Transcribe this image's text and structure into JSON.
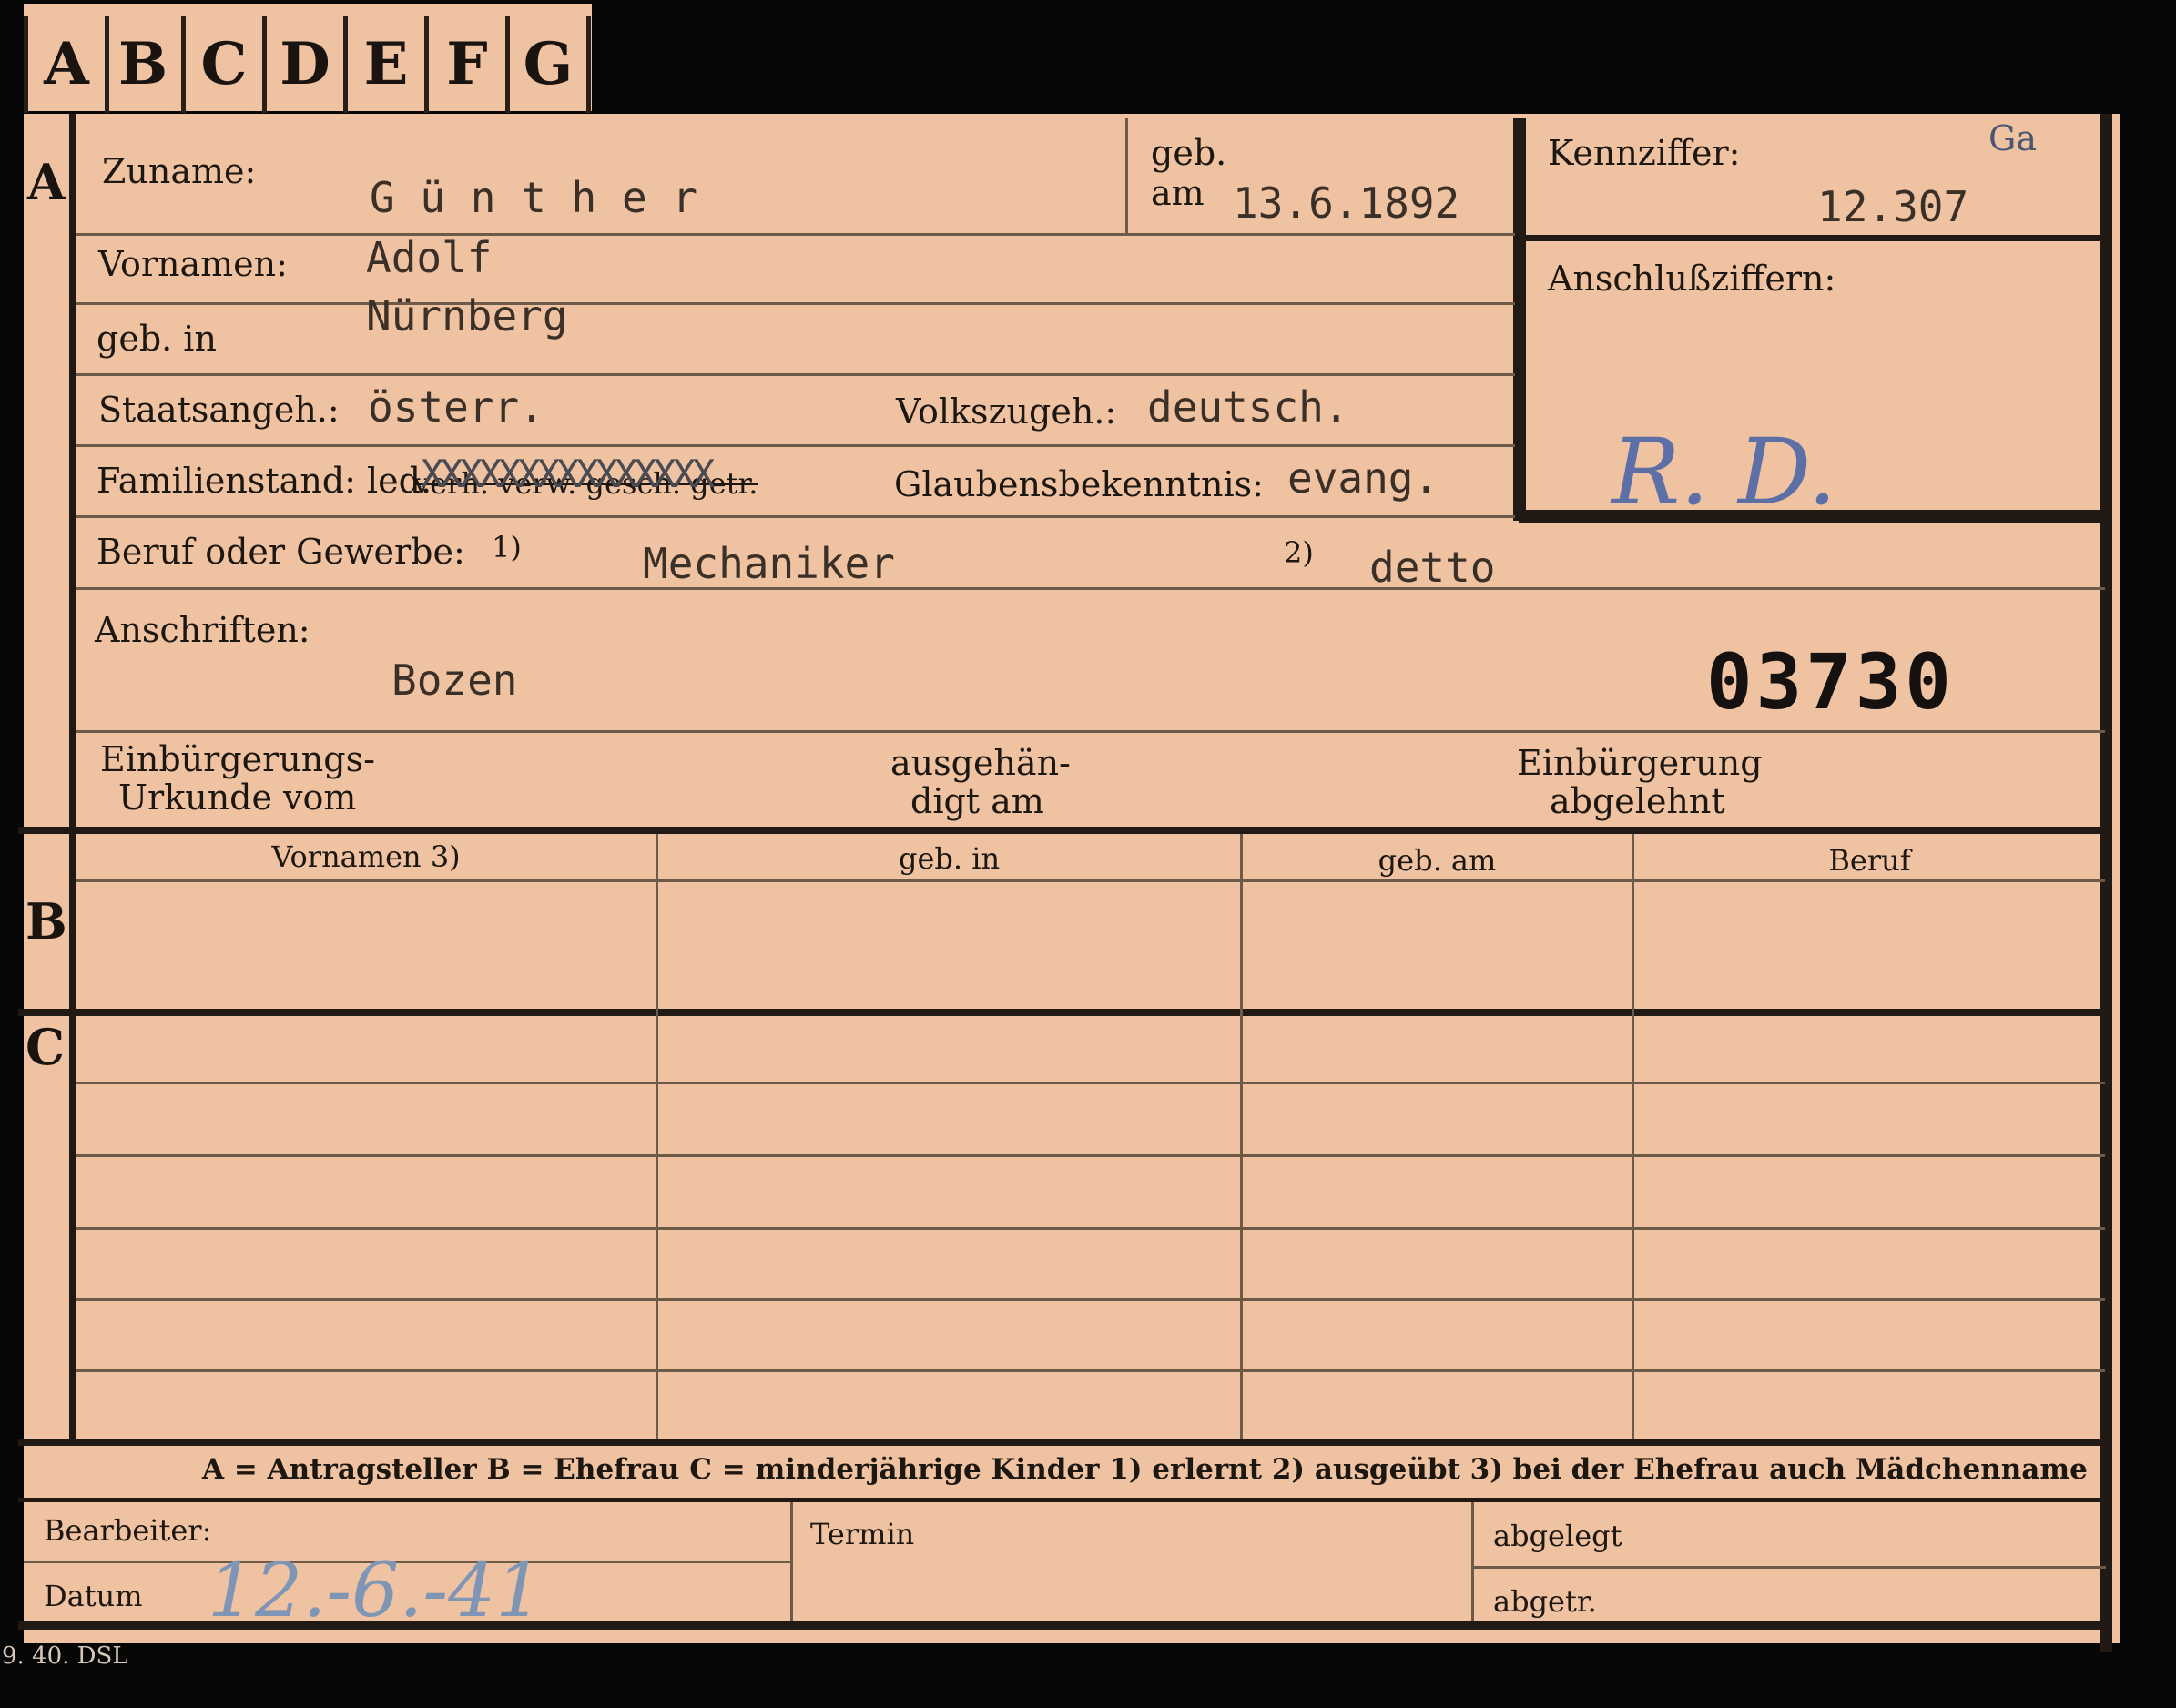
{
  "tabs": [
    "A",
    "B",
    "C",
    "D",
    "E",
    "F",
    "G"
  ],
  "sections": {
    "a": "A",
    "b": "B",
    "c": "C"
  },
  "labels": {
    "zuname": "Zuname:",
    "geb_top": "geb.",
    "geb_am": "am",
    "kennziffer": "Kennziffer:",
    "anschlussziffern": "Anschlußziffern:",
    "vornamen": "Vornamen:",
    "geb_in": "geb. in",
    "staatsangeh": "Staatsangeh.:",
    "volkszugeh": "Volkszugeh.:",
    "familienstand": "Familienstand: led.",
    "familienstand_crossed": "verh. verw. gesch. getr.",
    "glaubensbekenntnis": "Glaubensbekenntnis:",
    "beruf": "Beruf oder Gewerbe:",
    "fn1": "1)",
    "fn2": "2)",
    "anschriften": "Anschriften:",
    "einb_urkunde_1": "Einbürgerungs-",
    "einb_urkunde_2": "Urkunde vom",
    "ausgehaendigt_1": "ausgehän-",
    "ausgehaendigt_2": "digt am",
    "einb_abgelehnt_1": "Einbürgerung",
    "einb_abgelehnt_2": "abgelehnt",
    "bearbeiter": "Bearbeiter:",
    "datum": "Datum",
    "termin": "Termin",
    "abgelegt": "abgelegt",
    "abgetr": "abgetr."
  },
  "columns": [
    "Vornamen 3)",
    "geb. in",
    "geb. am",
    "Beruf"
  ],
  "legend": "A = Antragsteller   B = Ehefrau   C = minderjährige Kinder   1) erlernt   2) ausgeübt   3) bei der Ehefrau auch Mädchenname",
  "values": {
    "zuname": "G ü n t h e r",
    "geb_datum": "13.6.1892",
    "ga_mark": "Ga",
    "kennziffer": "12.307",
    "vornamen": "Adolf",
    "geburtsort": "Nürnberg",
    "staatsangeh": "österr.",
    "volkszugeh": "deutsch.",
    "strike_marks": "XXXXXXXXXXXXXXX",
    "glaube": "evang.",
    "beruf_erlernt": "Mechaniker",
    "beruf_ausgeuebt": "detto",
    "anschrift": "Bozen",
    "aktennummer": "03730",
    "initials": "R. D.",
    "datum_hand": "12.-6.-41"
  },
  "footer": "9. 40. DSL"
}
